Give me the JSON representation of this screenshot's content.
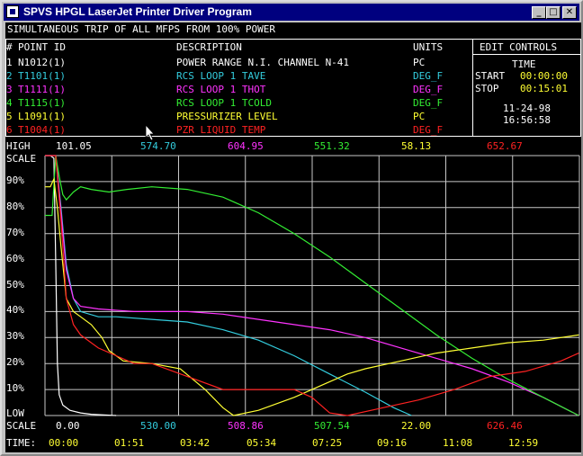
{
  "window": {
    "title": "SPVS HPGL LaserJet Printer Driver Program",
    "minimize_glyph": "_",
    "maximize_glyph": "□",
    "close_glyph": "✕"
  },
  "banner": "SIMULTANEOUS TRIP OF ALL MFPS FROM 100% POWER",
  "table": {
    "headers": {
      "num": "#",
      "point_id": "POINT ID",
      "description": "DESCRIPTION",
      "units": "UNITS"
    },
    "rows": [
      {
        "num": "1",
        "id": "N1012(1)",
        "desc": "POWER RANGE N.I. CHANNEL N-41",
        "units": "PC",
        "color": "#ffffff"
      },
      {
        "num": "2",
        "id": "T1101(1)",
        "desc": "RCS LOOP 1 TAVE",
        "units": "DEG_F",
        "color": "#33ccdd"
      },
      {
        "num": "3",
        "id": "T1111(1)",
        "desc": "RCS LOOP 1 THOT",
        "units": "DEG_F",
        "color": "#ff33ff"
      },
      {
        "num": "4",
        "id": "T1115(1)",
        "desc": "RCS LOOP 1 TCOLD",
        "units": "DEG_F",
        "color": "#33ee33"
      },
      {
        "num": "5",
        "id": "L1091(1)",
        "desc": "PRESSURIZER LEVEL",
        "units": "PC",
        "color": "#ffff33"
      },
      {
        "num": "6",
        "id": "T1004(1)",
        "desc": "PZR LIQUID TEMP",
        "units": "DEG_F",
        "color": "#ff2222"
      }
    ]
  },
  "controls": {
    "edit_label": "EDIT CONTROLS",
    "time_label": "TIME",
    "start_label": "START",
    "start_value": "00:00:00",
    "stop_label": "STOP",
    "stop_value": "00:15:01",
    "date": "11-24-98",
    "clock": "16:56:58",
    "value_color": "#ffff33"
  },
  "high": {
    "label": "HIGH",
    "values": [
      "101.05",
      "574.70",
      "604.95",
      "551.32",
      "58.13",
      "652.67"
    ]
  },
  "low": {
    "label_low": "LOW",
    "label_scale": "SCALE",
    "values": [
      "0.00",
      "530.00",
      "508.86",
      "507.54",
      "22.00",
      "626.46"
    ]
  },
  "scale_label": "SCALE",
  "time_axis": {
    "label": "TIME:",
    "ticks": [
      "00:00",
      "01:51",
      "03:42",
      "05:34",
      "07:25",
      "09:16",
      "11:08",
      "12:59"
    ]
  },
  "chart_data": {
    "type": "line",
    "x_unit": "minutes",
    "xlim": [
      0,
      15.0167
    ],
    "ylim": [
      0,
      100
    ],
    "y_ticks": [
      "10%",
      "20%",
      "30%",
      "40%",
      "50%",
      "60%",
      "70%",
      "80%",
      "90%"
    ],
    "grid": true,
    "series": [
      {
        "name": "N1012(1)",
        "color": "#ffffff",
        "points": [
          [
            0,
            100
          ],
          [
            0.15,
            100
          ],
          [
            0.25,
            99
          ],
          [
            0.3,
            60
          ],
          [
            0.35,
            20
          ],
          [
            0.4,
            8
          ],
          [
            0.5,
            4
          ],
          [
            0.7,
            2
          ],
          [
            1.0,
            1
          ],
          [
            1.3,
            0.5
          ],
          [
            2.0,
            0
          ]
        ]
      },
      {
        "name": "T1101(1)",
        "color": "#33ccdd",
        "points": [
          [
            0,
            100
          ],
          [
            0.2,
            100
          ],
          [
            0.3,
            100
          ],
          [
            0.45,
            80
          ],
          [
            0.6,
            58
          ],
          [
            0.8,
            45
          ],
          [
            1.0,
            40
          ],
          [
            1.5,
            38
          ],
          [
            2.0,
            38
          ],
          [
            3.0,
            37
          ],
          [
            4.0,
            36
          ],
          [
            5.0,
            33
          ],
          [
            6.0,
            29
          ],
          [
            7.0,
            23
          ],
          [
            8.0,
            16
          ],
          [
            9.0,
            9
          ],
          [
            9.8,
            3
          ],
          [
            10.3,
            0
          ]
        ]
      },
      {
        "name": "T1111(1)",
        "color": "#ff33ff",
        "points": [
          [
            0,
            100
          ],
          [
            0.2,
            100
          ],
          [
            0.3,
            100
          ],
          [
            0.45,
            78
          ],
          [
            0.6,
            56
          ],
          [
            0.8,
            45
          ],
          [
            1.0,
            42
          ],
          [
            1.5,
            41
          ],
          [
            2.5,
            40
          ],
          [
            4.0,
            40
          ],
          [
            5.0,
            39
          ],
          [
            6.0,
            37
          ],
          [
            7.0,
            35
          ],
          [
            8.0,
            33
          ],
          [
            9.0,
            30
          ],
          [
            10.0,
            26
          ],
          [
            11.0,
            22
          ],
          [
            12.0,
            18
          ],
          [
            13.0,
            13
          ],
          [
            14.0,
            7
          ],
          [
            15.0,
            0
          ]
        ]
      },
      {
        "name": "T1115(1)",
        "color": "#33ee33",
        "points": [
          [
            0,
            77
          ],
          [
            0.2,
            77
          ],
          [
            0.3,
            100
          ],
          [
            0.4,
            92
          ],
          [
            0.5,
            85
          ],
          [
            0.6,
            83
          ],
          [
            0.8,
            86
          ],
          [
            1.0,
            88
          ],
          [
            1.3,
            87
          ],
          [
            1.8,
            86
          ],
          [
            2.3,
            87
          ],
          [
            3.0,
            88
          ],
          [
            4.0,
            87
          ],
          [
            5.0,
            84
          ],
          [
            6.0,
            78
          ],
          [
            7.0,
            70
          ],
          [
            8.0,
            61
          ],
          [
            9.0,
            51
          ],
          [
            10.0,
            41
          ],
          [
            11.0,
            31
          ],
          [
            12.0,
            22
          ],
          [
            13.0,
            14
          ],
          [
            14.0,
            7
          ],
          [
            15.0,
            0
          ]
        ]
      },
      {
        "name": "L1091(1)",
        "color": "#ffff33",
        "points": [
          [
            0,
            88
          ],
          [
            0.15,
            88
          ],
          [
            0.25,
            91
          ],
          [
            0.35,
            80
          ],
          [
            0.45,
            65
          ],
          [
            0.6,
            45
          ],
          [
            0.8,
            40
          ],
          [
            1.0,
            38
          ],
          [
            1.3,
            35
          ],
          [
            1.6,
            30
          ],
          [
            1.8,
            25
          ],
          [
            2.2,
            21
          ],
          [
            3.0,
            20
          ],
          [
            3.8,
            18
          ],
          [
            4.5,
            10
          ],
          [
            5.0,
            3
          ],
          [
            5.3,
            0
          ],
          [
            6.0,
            2
          ],
          [
            7.0,
            7
          ],
          [
            8.0,
            13
          ],
          [
            8.5,
            16
          ],
          [
            9.0,
            18
          ],
          [
            10.0,
            21
          ],
          [
            11.0,
            24
          ],
          [
            12.0,
            26
          ],
          [
            13.0,
            28
          ],
          [
            14.0,
            29
          ],
          [
            15.0,
            31
          ]
        ]
      },
      {
        "name": "T1004(1)",
        "color": "#ff2222",
        "points": [
          [
            0,
            100
          ],
          [
            0.2,
            100
          ],
          [
            0.3,
            100
          ],
          [
            0.45,
            75
          ],
          [
            0.6,
            45
          ],
          [
            0.8,
            35
          ],
          [
            1.0,
            31
          ],
          [
            1.5,
            26
          ],
          [
            2.0,
            23
          ],
          [
            2.5,
            20
          ],
          [
            3.0,
            20
          ],
          [
            4.0,
            15
          ],
          [
            5.0,
            10
          ],
          [
            6.0,
            10
          ],
          [
            7.0,
            10
          ],
          [
            7.5,
            7
          ],
          [
            8.0,
            1
          ],
          [
            8.5,
            0
          ],
          [
            9.5,
            3
          ],
          [
            10.5,
            6
          ],
          [
            11.5,
            10
          ],
          [
            12.5,
            15
          ],
          [
            13.5,
            17
          ],
          [
            14.5,
            21
          ],
          [
            15.0,
            24
          ]
        ]
      }
    ]
  }
}
